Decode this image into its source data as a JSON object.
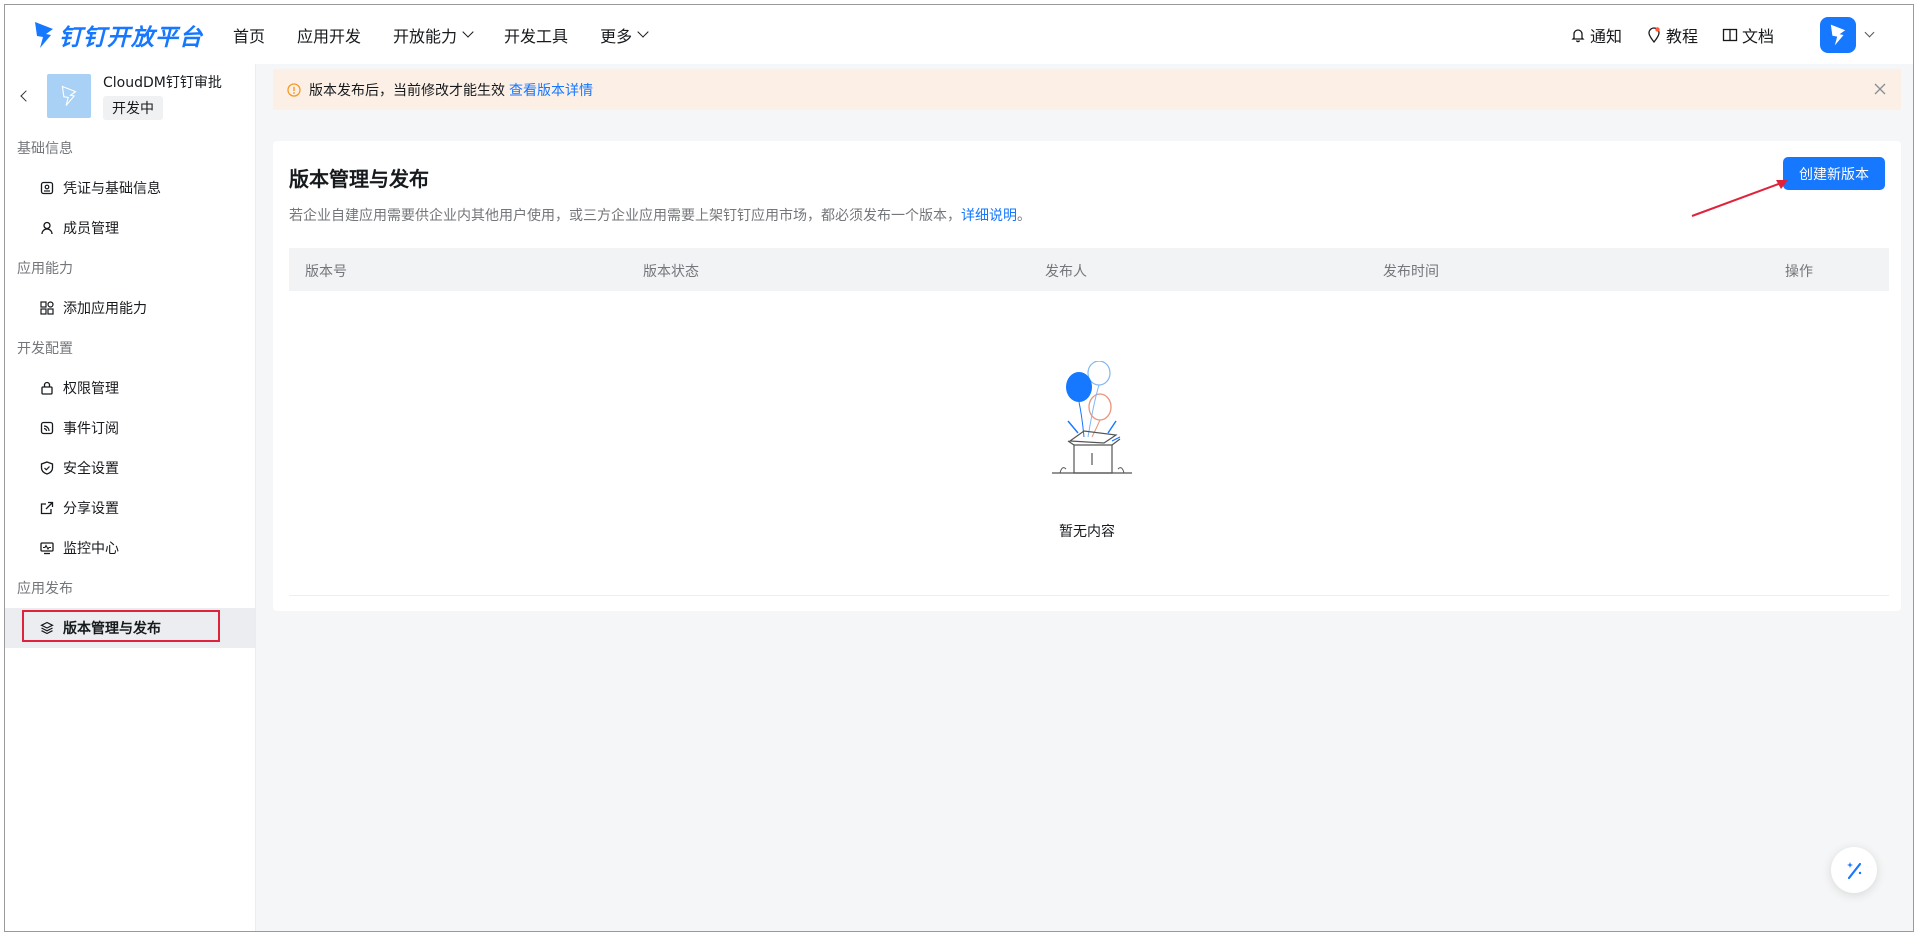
{
  "brand": {
    "name": "钉钉开放平台"
  },
  "nav": {
    "items": [
      {
        "label": "首页"
      },
      {
        "label": "应用开发"
      },
      {
        "label": "开放能力"
      },
      {
        "label": "开发工具"
      },
      {
        "label": "更多"
      }
    ],
    "right": {
      "notify": "通知",
      "tutorial": "教程",
      "docs": "文档"
    }
  },
  "app": {
    "name": "CloudDM钉钉审批",
    "status": "开发中"
  },
  "sidebar": {
    "groups": [
      {
        "label": "基础信息",
        "items": [
          {
            "label": "凭证与基础信息",
            "icon": "credential-icon"
          },
          {
            "label": "成员管理",
            "icon": "member-icon"
          }
        ]
      },
      {
        "label": "应用能力",
        "items": [
          {
            "label": "添加应用能力",
            "icon": "apps-icon"
          }
        ]
      },
      {
        "label": "开发配置",
        "items": [
          {
            "label": "权限管理",
            "icon": "lock-icon"
          },
          {
            "label": "事件订阅",
            "icon": "rss-icon"
          },
          {
            "label": "安全设置",
            "icon": "shield-icon"
          },
          {
            "label": "分享设置",
            "icon": "share-icon"
          },
          {
            "label": "监控中心",
            "icon": "monitor-icon"
          }
        ]
      },
      {
        "label": "应用发布",
        "items": [
          {
            "label": "版本管理与发布",
            "icon": "layers-icon",
            "active": true
          }
        ]
      }
    ]
  },
  "banner": {
    "text": "版本发布后，当前修改才能生效",
    "link": "查看版本详情"
  },
  "page": {
    "title": "版本管理与发布",
    "description": "若企业自建应用需要供企业内其他用户使用，或三方企业应用需要上架钉钉应用市场，都必须发布一个版本，",
    "description_link": "详细说明",
    "description_end": "。",
    "create_button": "创建新版本"
  },
  "table": {
    "columns": [
      "版本号",
      "版本状态",
      "发布人",
      "发布时间",
      "操作"
    ],
    "rows": [],
    "empty_text": "暂无内容"
  },
  "colors": {
    "accent": "#1677ff",
    "banner_bg": "#fcefe6",
    "highlight": "#e0233c"
  }
}
